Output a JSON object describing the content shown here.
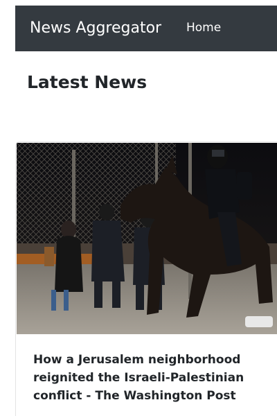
{
  "navbar": {
    "brand": "News Aggregator",
    "links": [
      {
        "label": "Home"
      }
    ]
  },
  "main": {
    "heading": "Latest News",
    "articles": [
      {
        "title": "How a Jerusalem neighborhood reignited the Israeli-Palestinian conflict - The Washington Post",
        "image_icon": "news-photo"
      }
    ]
  }
}
